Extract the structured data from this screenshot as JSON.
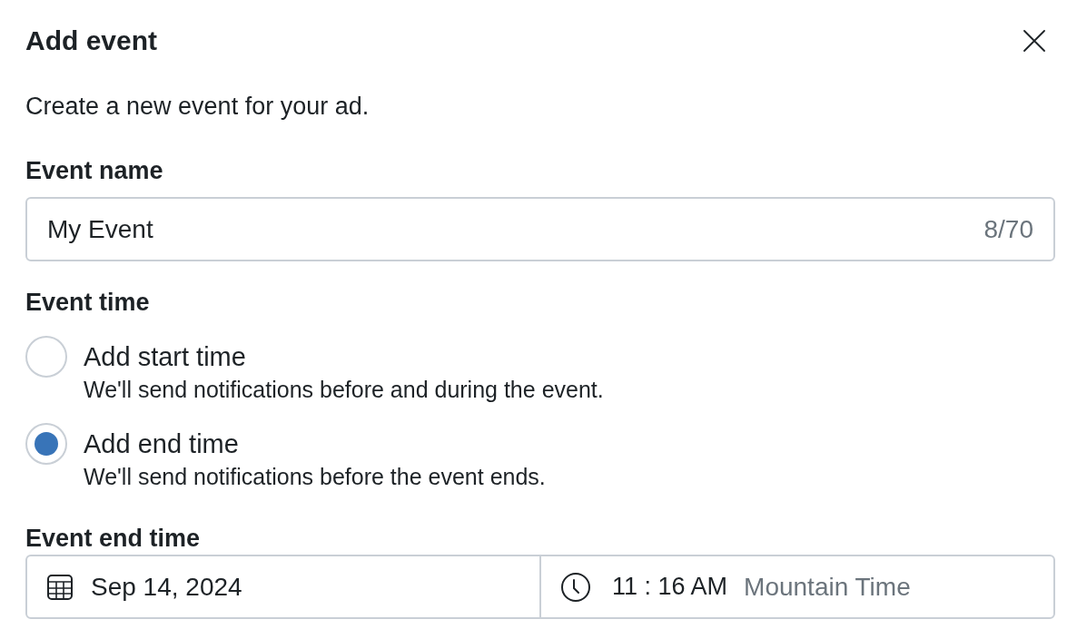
{
  "dialog": {
    "title": "Add event",
    "description": "Create a new event for your ad."
  },
  "event_name": {
    "label": "Event name",
    "value": "My Event",
    "counter": "8/70"
  },
  "event_time": {
    "label": "Event time",
    "options": [
      {
        "label": "Add start time",
        "hint": "We'll send notifications before and during the event.",
        "selected": false
      },
      {
        "label": "Add end time",
        "hint": "We'll send notifications before the event ends.",
        "selected": true
      }
    ]
  },
  "event_end_time": {
    "label": "Event end time",
    "date": "Sep 14, 2024",
    "time": "11 : 16 AM",
    "timezone": "Mountain Time"
  }
}
